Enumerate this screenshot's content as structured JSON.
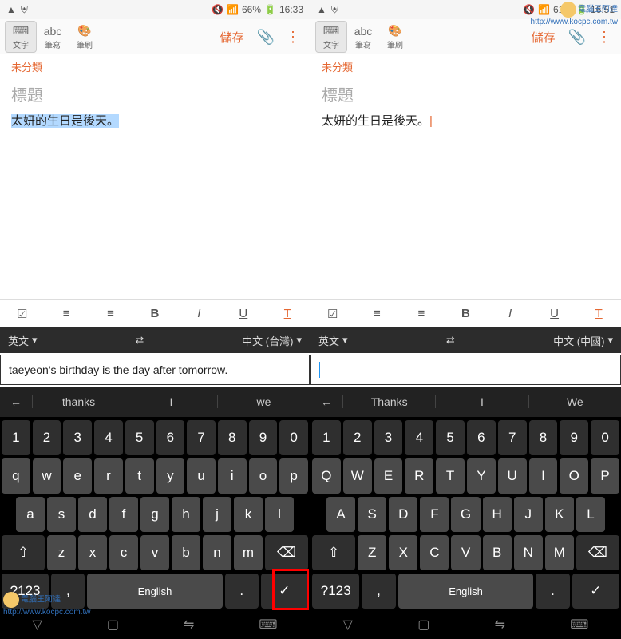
{
  "left": {
    "status": {
      "battery": "66%",
      "time": "16:33"
    },
    "toolbar": {
      "text": "文字",
      "hand": "筆寫",
      "brush": "筆刷",
      "save": "儲存"
    },
    "category": "未分類",
    "title_ph": "標題",
    "content": "太妍的生日是後天。",
    "content_selected": true,
    "lang": {
      "left": "英文",
      "right": "中文 (台灣)"
    },
    "input": "taeyeon's birthday is the day after tomorrow.",
    "sugg": [
      "thanks",
      "I",
      "we"
    ],
    "space": "English",
    "caps": false
  },
  "right": {
    "status": {
      "battery": "61%",
      "time": "16:51"
    },
    "toolbar": {
      "text": "文字",
      "hand": "筆寫",
      "brush": "筆刷",
      "save": "儲存"
    },
    "category": "未分類",
    "title_ph": "標題",
    "content": "太妍的生日是後天。",
    "content_selected": false,
    "lang": {
      "left": "英文",
      "right": "中文 (中國)"
    },
    "input": "",
    "sugg": [
      "Thanks",
      "I",
      "We"
    ],
    "space": "English",
    "caps": true
  },
  "keys": {
    "num": [
      "1",
      "2",
      "3",
      "4",
      "5",
      "6",
      "7",
      "8",
      "9",
      "0"
    ],
    "r1_low": [
      "q",
      "w",
      "e",
      "r",
      "t",
      "y",
      "u",
      "i",
      "o",
      "p"
    ],
    "r2_low": [
      "a",
      "s",
      "d",
      "f",
      "g",
      "h",
      "j",
      "k",
      "l"
    ],
    "r3_low": [
      "z",
      "x",
      "c",
      "v",
      "b",
      "n",
      "m"
    ],
    "r1_up": [
      "Q",
      "W",
      "E",
      "R",
      "T",
      "Y",
      "U",
      "I",
      "O",
      "P"
    ],
    "r2_up": [
      "A",
      "S",
      "D",
      "F",
      "G",
      "H",
      "J",
      "K",
      "L"
    ],
    "r3_up": [
      "Z",
      "X",
      "C",
      "V",
      "B",
      "N",
      "M"
    ],
    "sym": "?123",
    "comma": ",",
    "period": "."
  },
  "wm": {
    "name": "電腦王阿達",
    "url": "http://www.kocpc.com.tw"
  }
}
